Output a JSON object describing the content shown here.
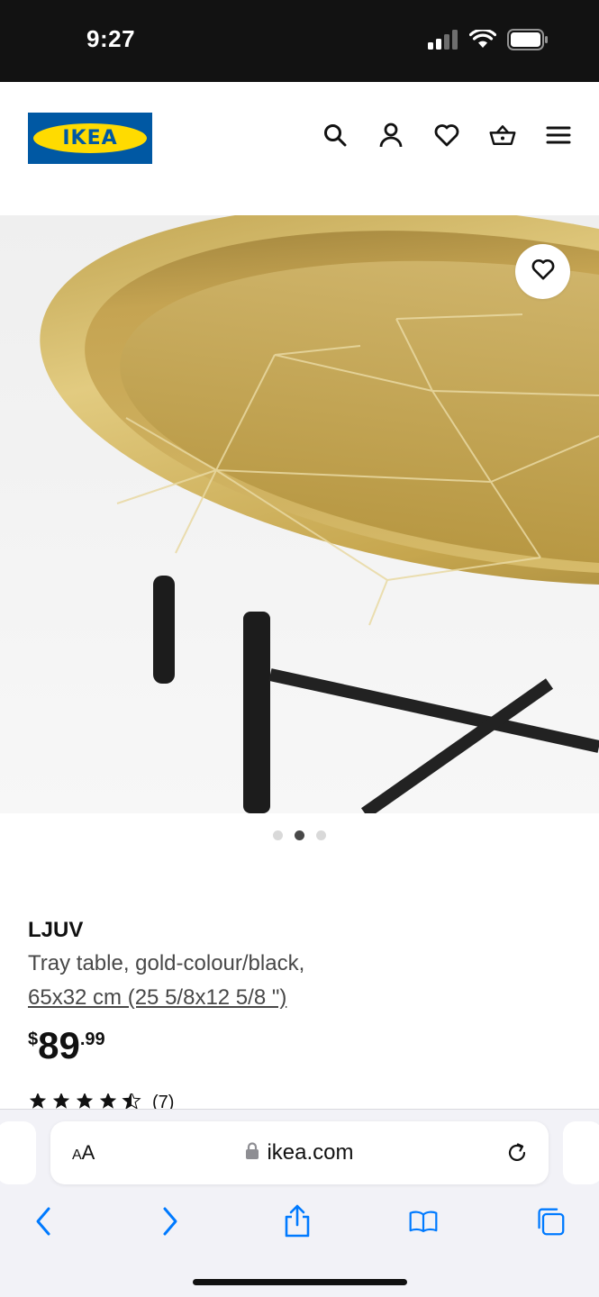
{
  "status_bar": {
    "time": "9:27"
  },
  "header": {
    "logo_text": "IKEA"
  },
  "carousel": {
    "dots": 3,
    "active_index": 1
  },
  "product": {
    "name": "LJUV",
    "description": "Tray table, gold-colour/black,",
    "size": "65x32 cm (25 5/8x12 5/8 \")",
    "price": {
      "currency": "$",
      "integer": "89",
      "decimal": ".99"
    },
    "rating": {
      "stars": 4.5,
      "count": "(7)"
    }
  },
  "browser": {
    "text_size_label": "AA",
    "url": "ikea.com"
  },
  "colors": {
    "ikea_blue": "#0058a3",
    "ikea_yellow": "#ffdb00",
    "safari_blue": "#007aff"
  }
}
